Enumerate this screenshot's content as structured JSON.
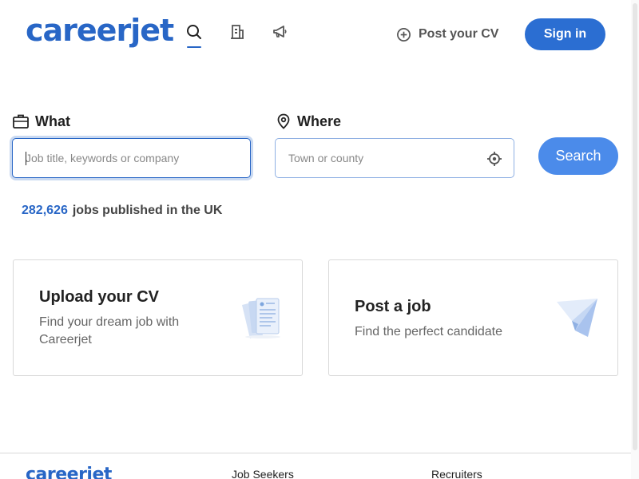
{
  "brand": {
    "logo": "careerjet",
    "accent": "#2866c6"
  },
  "header": {
    "nav_icons": [
      "search-icon",
      "building-icon",
      "megaphone-icon"
    ],
    "post_cv_label": "Post your CV",
    "sign_in_label": "Sign in"
  },
  "search": {
    "what_label": "What",
    "what_placeholder": "Job title, keywords or company",
    "what_value": "",
    "where_label": "Where",
    "where_placeholder": "Town or county",
    "where_value": "",
    "button_label": "Search"
  },
  "stats": {
    "job_count": "282,626",
    "job_count_suffix": "jobs published in the UK"
  },
  "cards": [
    {
      "title": "Upload your CV",
      "subtitle": "Find your dream job with Careerjet",
      "icon": "documents-icon"
    },
    {
      "title": "Post a job",
      "subtitle": "Find the perfect candidate",
      "icon": "paper-plane-icon"
    }
  ],
  "footer": {
    "logo": "careerjet",
    "columns": [
      "Job Seekers",
      "Recruiters"
    ]
  }
}
